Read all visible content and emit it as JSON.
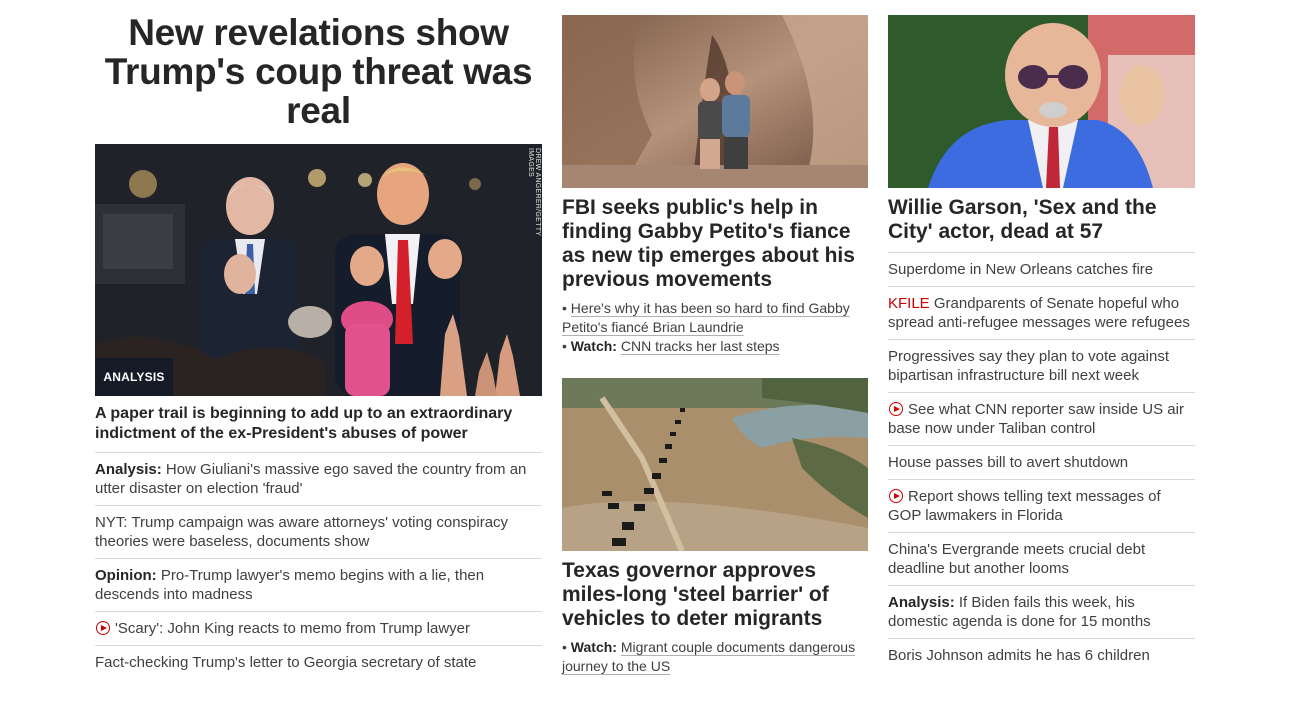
{
  "col1": {
    "headline": "New revelations show Trump's coup threat was real",
    "hero": {
      "image_alt": "Mike Pence and Donald Trump clapping at a rally",
      "badge": "ANALYSIS",
      "credit": "DREW ANGERER/GETTY IMAGES"
    },
    "lead": "A paper trail is beginning to add up to an extraordinary indictment of the ex-President's abuses of power",
    "items": [
      {
        "prefix": "Analysis:",
        "text": "How Giuliani's massive ego saved the country from an utter disaster on election 'fraud'"
      },
      {
        "text": "NYT: Trump campaign was aware attorneys' voting conspiracy theories were baseless, documents show"
      },
      {
        "prefix": "Opinion:",
        "text": "Pro-Trump lawyer's memo begins with a lie, then descends into madness"
      },
      {
        "video": true,
        "text": "'Scary': John King reacts to memo from Trump lawyer"
      },
      {
        "text": "Fact-checking Trump's letter to Georgia secretary of state"
      }
    ]
  },
  "col2": {
    "story1": {
      "image_alt": "Gabby Petito and Brian Laundrie in a canyon",
      "headline": "FBI seeks public's help in finding Gabby Petito's fiance as new tip emerges about his previous movements",
      "bullets": [
        {
          "text": "Here's why it has been so hard to find Gabby Petito's fiancé Brian Laundrie"
        },
        {
          "prefix": "Watch:",
          "text": "CNN tracks her last steps"
        }
      ]
    },
    "story2": {
      "image_alt": "Aerial view of vehicles lined along the Rio Grande",
      "headline": "Texas governor approves miles-long 'steel barrier' of vehicles to deter migrants",
      "bullets": [
        {
          "prefix": "Watch:",
          "text": "Migrant couple documents dangerous journey to the US"
        }
      ]
    }
  },
  "col3": {
    "image_alt": "Willie Garson in a blue suit",
    "headline": "Willie Garson, 'Sex and the City' actor, dead at 57",
    "items": [
      {
        "text": "Superdome in New Orleans catches fire"
      },
      {
        "kicker": "KFILE",
        "text": "Grandparents of Senate hopeful who spread anti-refugee messages were refugees"
      },
      {
        "text": "Progressives say they plan to vote against bipartisan infrastructure bill next week"
      },
      {
        "video": true,
        "text": "See what CNN reporter saw inside US air base now under Taliban control"
      },
      {
        "text": "House passes bill to avert shutdown"
      },
      {
        "video": true,
        "text": "Report shows telling text messages of GOP lawmakers in Florida"
      },
      {
        "text": "China's Evergrande meets crucial debt deadline but another looms"
      },
      {
        "prefix": "Analysis:",
        "text": "If Biden fails this week, his domestic agenda is done for 15 months"
      },
      {
        "text": "Boris Johnson admits he has 6 children"
      }
    ]
  }
}
